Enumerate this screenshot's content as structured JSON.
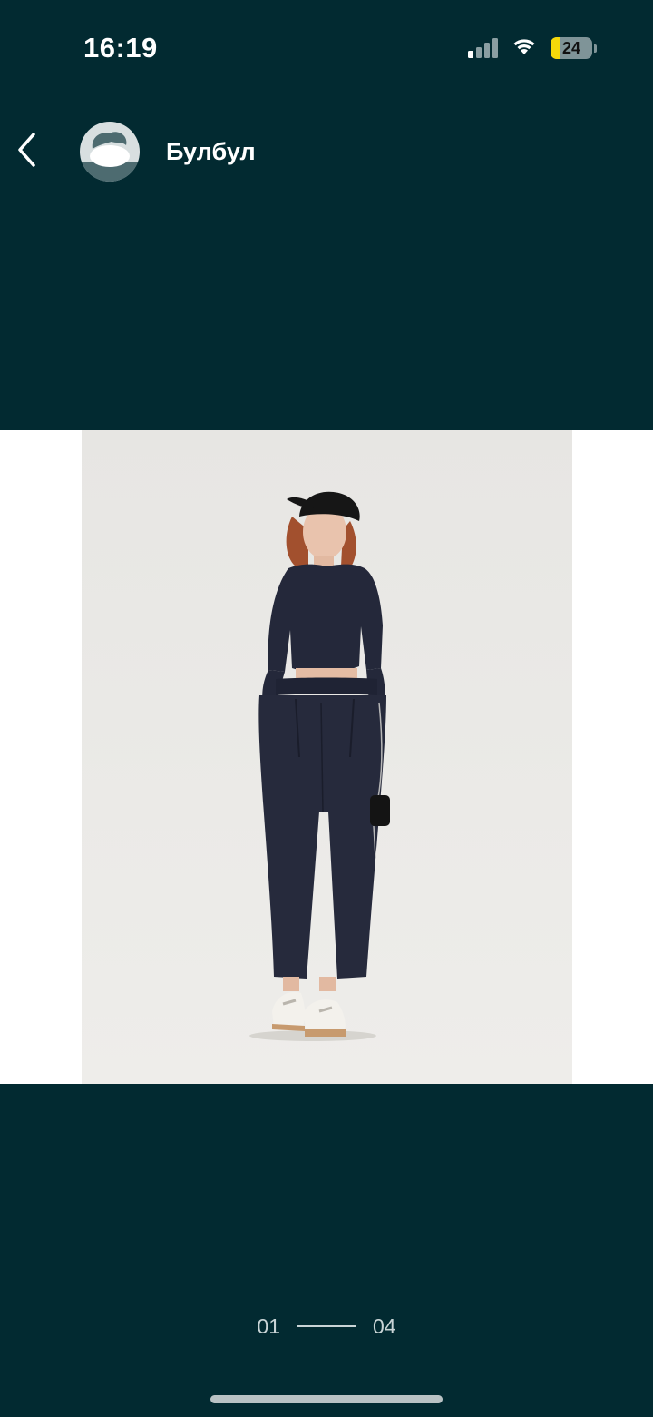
{
  "status_bar": {
    "time": "16:19",
    "signal_bars_active": 1,
    "signal_bars_total": 4,
    "wifi_icon": "wifi-icon",
    "battery_level": "24",
    "battery_percent": 24,
    "battery_color": "#f5d90a"
  },
  "header": {
    "back_icon": "chevron-left-icon",
    "avatar_icon": "default-avatar-icon",
    "username": "Булбул"
  },
  "viewer": {
    "photo_description_icon": "product-photo",
    "current_index": "01",
    "total_count": "04"
  },
  "colors": {
    "background": "#022a31",
    "photo_band": "#ffffff",
    "pager_text": "#c9d4d6"
  }
}
